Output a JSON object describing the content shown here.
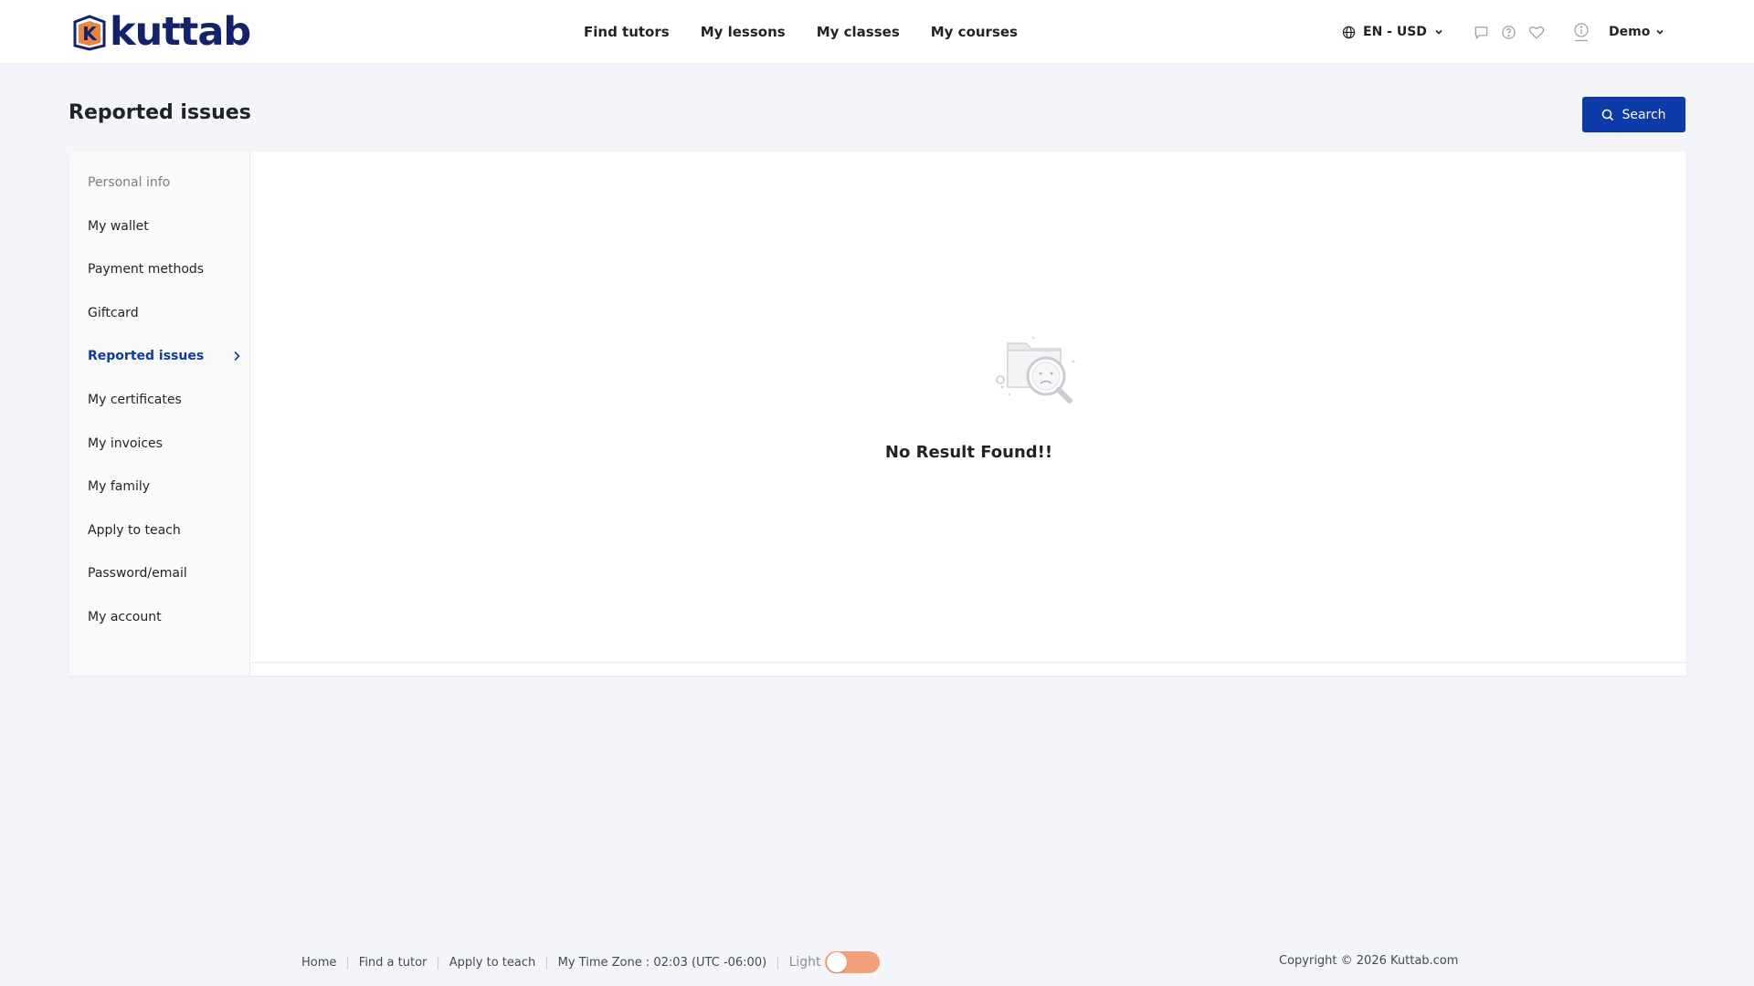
{
  "brand": {
    "name": "kuttab",
    "mark_letter": "K"
  },
  "nav": {
    "items": [
      {
        "label": "Find tutors"
      },
      {
        "label": "My lessons"
      },
      {
        "label": "My classes"
      },
      {
        "label": "My courses"
      }
    ]
  },
  "header": {
    "language_currency": "EN - USD",
    "user_name": "Demo",
    "icons": [
      "globe-icon",
      "chat-icon",
      "help-icon",
      "heart-icon",
      "info-icon"
    ]
  },
  "page": {
    "title": "Reported issues",
    "search_button_label": "Search"
  },
  "sidebar": {
    "items": [
      {
        "label": "Personal info"
      },
      {
        "label": "My wallet"
      },
      {
        "label": "Payment methods"
      },
      {
        "label": "Giftcard"
      },
      {
        "label": "Reported issues"
      },
      {
        "label": "My certificates"
      },
      {
        "label": "My invoices"
      },
      {
        "label": "My family"
      },
      {
        "label": "Apply to teach"
      },
      {
        "label": "Password/email"
      },
      {
        "label": "My account"
      }
    ],
    "active_index": 4
  },
  "empty_state": {
    "message": "No Result Found!!"
  },
  "footer": {
    "links": [
      {
        "label": "Home"
      },
      {
        "label": "Find a tutor"
      },
      {
        "label": "Apply to teach"
      }
    ],
    "timezone": "My Time Zone : 02:03 (UTC -06:00)",
    "theme_label": "Light",
    "copyright": "Copyright © 2026 Kuttab.com"
  },
  "colors": {
    "primary": "#0d3aa9",
    "brand_navy": "#14216b",
    "brand_orange": "#e8792b",
    "toggle": "#f4a07b",
    "page_bg": "#f4f5f8"
  }
}
